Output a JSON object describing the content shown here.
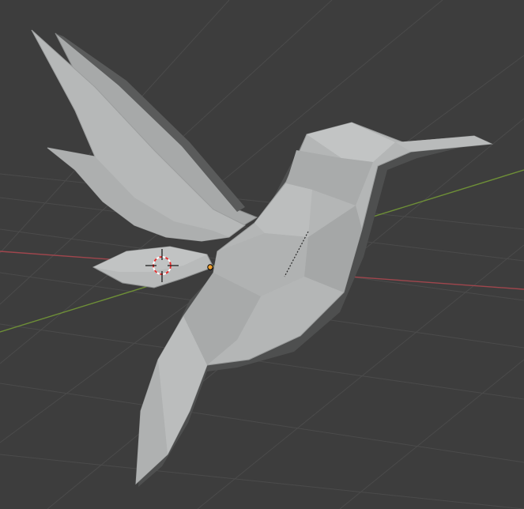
{
  "viewport": {
    "background": "#3d3d3d",
    "grid_color": "#4b4b4b",
    "x_axis_color": "#a0464d",
    "y_axis_color": "#6e8f37"
  },
  "object": {
    "icon": "hummingbird-mesh",
    "base_color": "#b4b6b6",
    "shadow_color": "#4e4f4f",
    "origin_color": "#f0a030"
  },
  "cursor_3d": {
    "icon": "3d-cursor-icon",
    "ring_colors": [
      "#ffffff",
      "#e03030"
    ],
    "crosshair_color": "#111111"
  }
}
